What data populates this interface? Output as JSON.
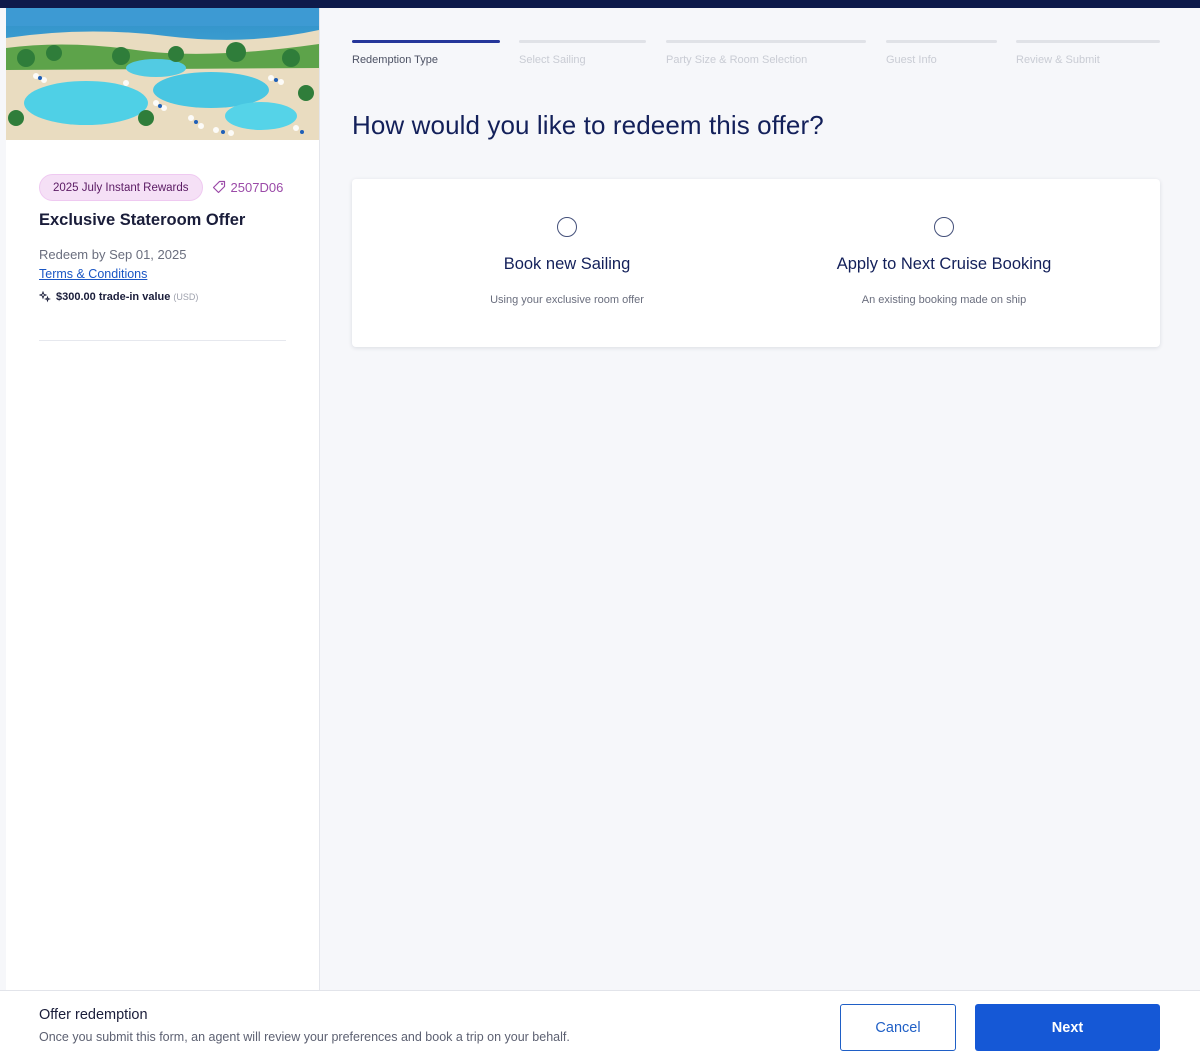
{
  "colors": {
    "brand_navy": "#0e1a4b",
    "primary": "#1558d6",
    "pill_bg": "#f5e0f6",
    "code_purple": "#9b4aa8"
  },
  "sidebar": {
    "hero_image": "resort-pool-beach-photo",
    "reward_pill": "2025 July Instant Rewards",
    "tag_icon": "tag-icon",
    "offer_code": "2507D06",
    "offer_title": "Exclusive Stateroom Offer",
    "redeem_by": "Redeem by Sep 01, 2025",
    "terms_link": "Terms & Conditions",
    "value_icon": "sparkle-icon",
    "trade_in_value": "$300.00 trade-in value",
    "currency": "(USD)"
  },
  "stepper": {
    "steps": [
      {
        "label": "Redemption Type",
        "active": true
      },
      {
        "label": "Select Sailing",
        "active": false
      },
      {
        "label": "Party Size & Room Selection",
        "active": false
      },
      {
        "label": "Guest Info",
        "active": false
      },
      {
        "label": "Review & Submit",
        "active": false
      }
    ]
  },
  "main": {
    "question": "How would you like to redeem this offer?",
    "options": [
      {
        "title": "Book new Sailing",
        "description": "Using your exclusive room offer",
        "selected": false
      },
      {
        "title": "Apply to Next Cruise Booking",
        "description": "An existing booking made on ship",
        "selected": false
      }
    ]
  },
  "footer": {
    "title": "Offer redemption",
    "description": "Once you submit this form, an agent will review your preferences and book a trip on your behalf.",
    "cancel_label": "Cancel",
    "next_label": "Next"
  }
}
